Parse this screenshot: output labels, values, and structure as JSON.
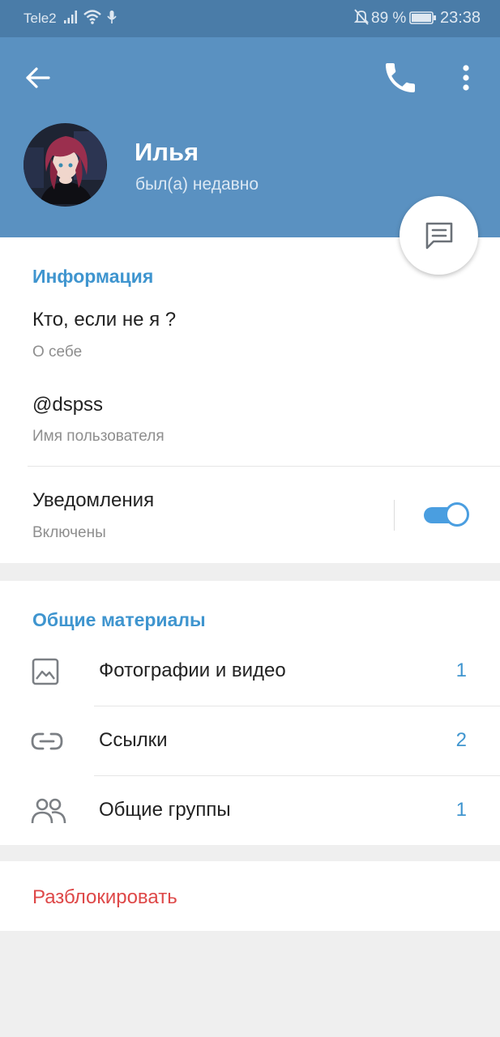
{
  "status_bar": {
    "carrier": "Tele2",
    "battery_percent": "89 %",
    "time": "23:38",
    "icons": [
      "signal-icon",
      "wifi-icon",
      "mic-icon",
      "bell-off-icon",
      "battery-icon"
    ]
  },
  "header": {
    "user_name": "Илья",
    "user_status": "был(а) недавно",
    "icons": [
      "back-arrow-icon",
      "phone-icon",
      "more-vertical-icon",
      "message-icon"
    ]
  },
  "info_section": {
    "title": "Информация",
    "bio_value": "Кто, если не я ?",
    "bio_label": "О себе",
    "username_value": "@dspss",
    "username_label": "Имя пользователя",
    "notifications_value": "Уведомления",
    "notifications_label": "Включены",
    "notifications_enabled": true
  },
  "media_section": {
    "title": "Общие материалы",
    "items": [
      {
        "label": "Фотографии и видео",
        "count": "1",
        "icon": "image-icon"
      },
      {
        "label": "Ссылки",
        "count": "2",
        "icon": "link-icon"
      },
      {
        "label": "Общие группы",
        "count": "1",
        "icon": "group-icon"
      }
    ]
  },
  "actions": {
    "unblock_label": "Разблокировать"
  },
  "colors": {
    "header": "#5a91c1",
    "status_bar": "#4a7ca8",
    "accent": "#3f95cf",
    "danger": "#de4848",
    "toggle": "#4a9ee0"
  }
}
